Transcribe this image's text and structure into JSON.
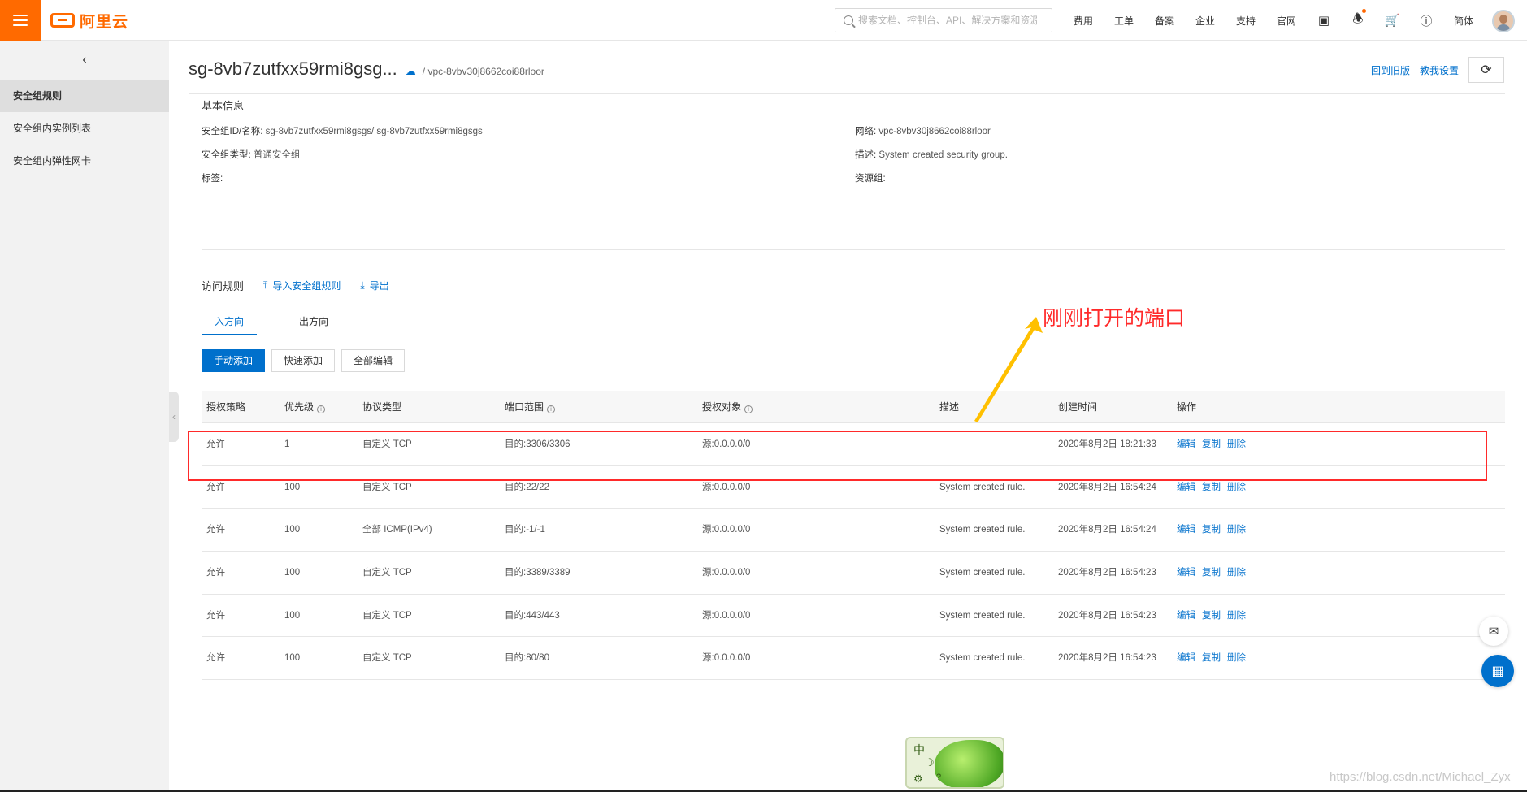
{
  "topbar": {
    "logo_text": "阿里云",
    "search_placeholder": "搜索文档、控制台、API、解决方案和资源",
    "nav": [
      "费用",
      "工单",
      "备案",
      "企业",
      "支持",
      "官网"
    ],
    "lang": "简体"
  },
  "sidebar": {
    "items": [
      {
        "label": "安全组规则",
        "active": true
      },
      {
        "label": "安全组内实例列表",
        "active": false
      },
      {
        "label": "安全组内弹性网卡",
        "active": false
      }
    ]
  },
  "header": {
    "title": "sg-8vb7zutfxx59rmi8gsg...",
    "vpc": "/ vpc-8vbv30j8662coi88rloor",
    "back_old": "回到旧版",
    "tutorial": "教我设置"
  },
  "basic_info": {
    "title": "基本信息",
    "id_label": "安全组ID/名称:",
    "id_value": "sg-8vb7zutfxx59rmi8gsgs/ sg-8vb7zutfxx59rmi8gsgs",
    "type_label": "安全组类型:",
    "type_value": "普通安全组",
    "tag_label": "标签:",
    "network_label": "网络:",
    "network_value": "vpc-8vbv30j8662coi88rloor",
    "desc_label": "描述:",
    "desc_value": "System created security group.",
    "rg_label": "资源组:"
  },
  "rules": {
    "title": "访问规则",
    "import": "导入安全组规则",
    "export": "导出",
    "tabs": [
      "入方向",
      "出方向"
    ],
    "buttons": {
      "manual": "手动添加",
      "quick": "快速添加",
      "edit_all": "全部编辑"
    },
    "columns": [
      "授权策略",
      "优先级",
      "协议类型",
      "端口范围",
      "授权对象",
      "描述",
      "创建时间",
      "操作"
    ],
    "ops": [
      "编辑",
      "复制",
      "删除"
    ],
    "rows": [
      {
        "policy": "允许",
        "priority": "1",
        "protocol": "自定义 TCP",
        "port": "目的:3306/3306",
        "object": "源:0.0.0.0/0",
        "desc": "",
        "time": "2020年8月2日 18:21:33"
      },
      {
        "policy": "允许",
        "priority": "100",
        "protocol": "自定义 TCP",
        "port": "目的:22/22",
        "object": "源:0.0.0.0/0",
        "desc": "System created rule.",
        "time": "2020年8月2日 16:54:24"
      },
      {
        "policy": "允许",
        "priority": "100",
        "protocol": "全部 ICMP(IPv4)",
        "port": "目的:-1/-1",
        "object": "源:0.0.0.0/0",
        "desc": "System created rule.",
        "time": "2020年8月2日 16:54:24"
      },
      {
        "policy": "允许",
        "priority": "100",
        "protocol": "自定义 TCP",
        "port": "目的:3389/3389",
        "object": "源:0.0.0.0/0",
        "desc": "System created rule.",
        "time": "2020年8月2日 16:54:23"
      },
      {
        "policy": "允许",
        "priority": "100",
        "protocol": "自定义 TCP",
        "port": "目的:443/443",
        "object": "源:0.0.0.0/0",
        "desc": "System created rule.",
        "time": "2020年8月2日 16:54:23"
      },
      {
        "policy": "允许",
        "priority": "100",
        "protocol": "自定义 TCP",
        "port": "目的:80/80",
        "object": "源:0.0.0.0/0",
        "desc": "System created rule.",
        "time": "2020年8月2日 16:54:23"
      }
    ]
  },
  "annotation": {
    "text": "刚刚打开的端口",
    "color": "#ff2a2a"
  },
  "ime": {
    "char": "中"
  },
  "watermark": "https://blog.csdn.net/Michael_Zyx",
  "colors": {
    "brand": "#ff6a00",
    "link": "#0070cc"
  }
}
